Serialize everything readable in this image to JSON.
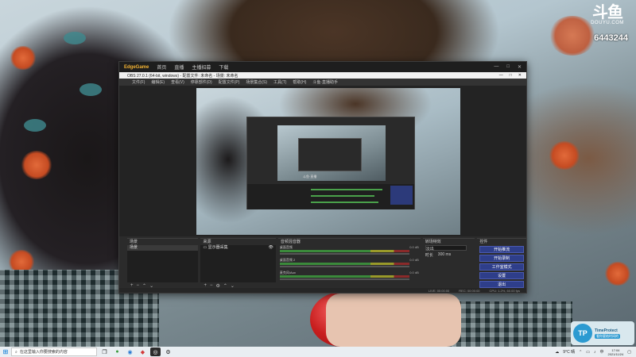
{
  "brand": {
    "logo": "斗鱼",
    "site": "DOUYU.COM",
    "room_id": "6443244"
  },
  "obs": {
    "app_name": "EdgeGame",
    "top_tabs": [
      "首页",
      "直播",
      "主播招募",
      "下载"
    ],
    "window_title": "OBS 27.0.1 (64-bit, windows) - 配置文件: 未命名 - 场景: 未命名",
    "menu": [
      "文件(F)",
      "编辑(E)",
      "查看(V)",
      "停靠部件(D)",
      "配置文件(P)",
      "场景集合(S)",
      "工具(T)",
      "帮助(H)",
      "斗鱼·直播助手"
    ],
    "preview_label": "斗鱼·直播",
    "docks": {
      "scenes": {
        "title": "场景",
        "items": [
          "场景"
        ]
      },
      "sources": {
        "title": "来源",
        "items": [
          "显示器采集"
        ]
      },
      "mixer": {
        "title": "音频混音器",
        "rows": [
          {
            "name": "桌面音频",
            "db": "0.0 dB"
          },
          {
            "name": "桌面音频 2",
            "db": "0.0 dB"
          },
          {
            "name": "麦克风/Aux",
            "db": "0.0 dB"
          }
        ]
      },
      "transitions": {
        "title": "转场特效",
        "selected": "淡出",
        "duration_label": "时长",
        "duration": "300 ms"
      },
      "controls": {
        "title": "控件",
        "buttons": [
          "开始推流",
          "开始录制",
          "工作室模式",
          "设置",
          "退出"
        ]
      }
    },
    "status": {
      "live": "LIVE: 00:00:00",
      "rec": "REC: 00:00:00",
      "cpu": "CPU: 1.2%, 60.00 fps"
    }
  },
  "tp_badge": {
    "icon": "TP",
    "title": "TimeProtect",
    "subtitle": "看你要结时间的"
  },
  "taskbar": {
    "search_placeholder": "在这里输入你要搜索的内容",
    "clock_time": "17:04",
    "clock_date": "2021/11/24",
    "weather": "9°C 晴",
    "ime": "中"
  }
}
